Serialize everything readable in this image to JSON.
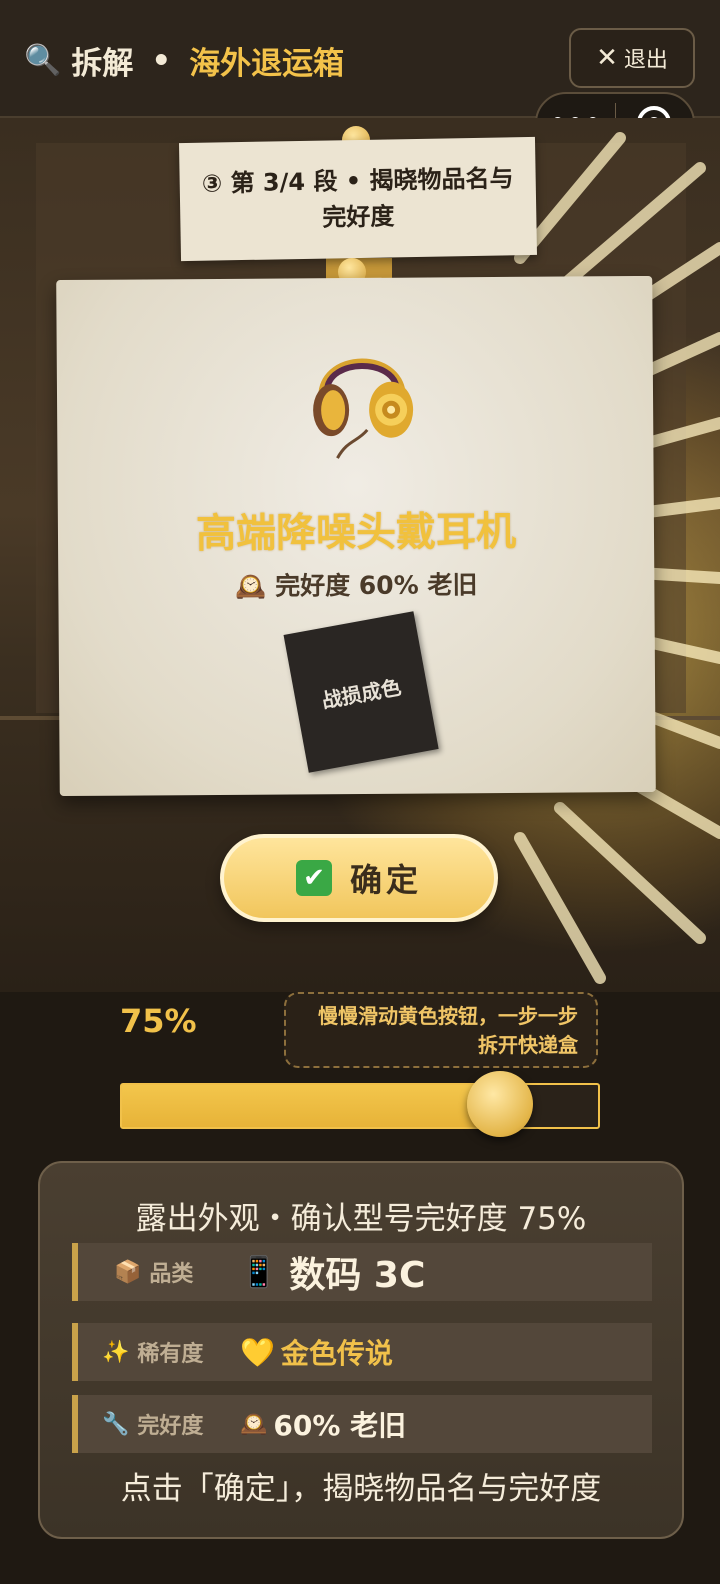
{
  "header": {
    "search_icon": "🔍",
    "title": "拆解",
    "separator": "•",
    "subtitle": "海外退运箱",
    "exit_label": "退出",
    "more_icon": "•••"
  },
  "scene": {
    "step_note": "③ 第 3/4 段 • 揭晓物品名与完好度",
    "item_name": "高端降噪头戴耳机",
    "condition_icon": "🕰️",
    "condition_text": "完好度 60% 老旧",
    "stamp_text": "战损成色",
    "confirm_icon": "✔",
    "confirm_label": "确定"
  },
  "progress": {
    "percent_text": "75%",
    "fraction": 0.75,
    "hint": "慢慢滑动黄色按钮，一步一步拆开快递盒"
  },
  "info": {
    "title": "露出外观・确认型号完好度 75%",
    "rows": [
      {
        "icon": "📦",
        "label": "品类",
        "value_icon": "📱",
        "value": "数码 3C"
      },
      {
        "icon": "✨",
        "label": "稀有度",
        "value_icon": "💛",
        "value": "金色传说"
      },
      {
        "icon": "🔧",
        "label": "完好度",
        "value_icon": "🕰️",
        "value": "60% 老旧"
      }
    ],
    "footer": "点击「确定」，揭晓物品名与完好度"
  },
  "colors": {
    "accent_gold": "#f1c14a",
    "header_bg": "#2d251c",
    "panel_bg": "#3c3327"
  }
}
